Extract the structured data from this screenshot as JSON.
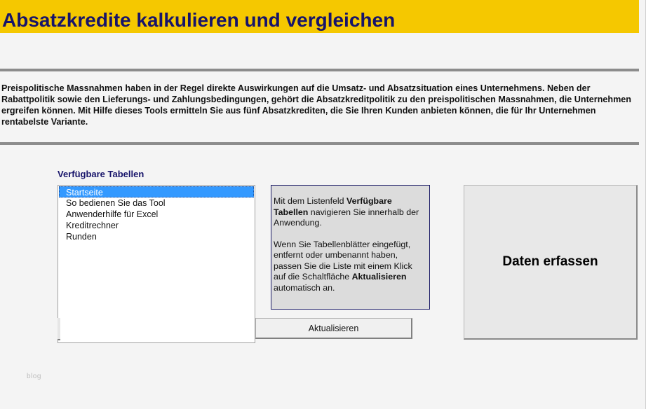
{
  "header": {
    "title": "Absatzkredite kalkulieren und vergleichen",
    "accent_color": "#f5c800",
    "title_color": "#17146a"
  },
  "intro": {
    "text": "Preispolitische  Massnahmen  haben in der Regel direkte Auswirkungen  auf die Umsatz-  und Absatzsituation  eines Unternehmens. Neben der Rabattpolitik sowie den Lieferungs-  und Zahlungsbedingungen,  gehört die Absatzkreditpolitik  zu den preispolitischen  Massnahmen, die Unternehmen ergreifen können. Mit Hilfe dieses Tools ermitteln Sie aus fünf Absatzkrediten, die Sie Ihren Kunden anbieten können, die für Ihr Unternehmen rentabelste Variante."
  },
  "navigation": {
    "heading": "Verfügbare Tabellen",
    "items": [
      {
        "label": "Startseite",
        "selected": true
      },
      {
        "label": "So bedienen Sie das Tool",
        "selected": false
      },
      {
        "label": "Anwenderhilfe für Excel",
        "selected": false
      },
      {
        "label": "Kreditrechner",
        "selected": false
      },
      {
        "label": "Runden",
        "selected": false
      }
    ],
    "refresh_label": "Aktualisieren",
    "selection_color": "#3399ff"
  },
  "info": {
    "p1_before": "Mit dem Listenfeld ",
    "p1_bold": "Verfügbare Tabellen",
    "p1_after": " navigieren  Sie innerhalb der Anwendung.",
    "p2_before": "Wenn Sie Tabellenblätter  eingefügt, entfernt  oder umbenannt  haben, passen Sie die Liste mit einem Klick auf die Schaltfläche ",
    "p2_bold": "Aktualisieren",
    "p2_after": " automatisch an."
  },
  "actions": {
    "data_entry_label": "Daten erfassen"
  },
  "watermark": {
    "text": "blog"
  }
}
